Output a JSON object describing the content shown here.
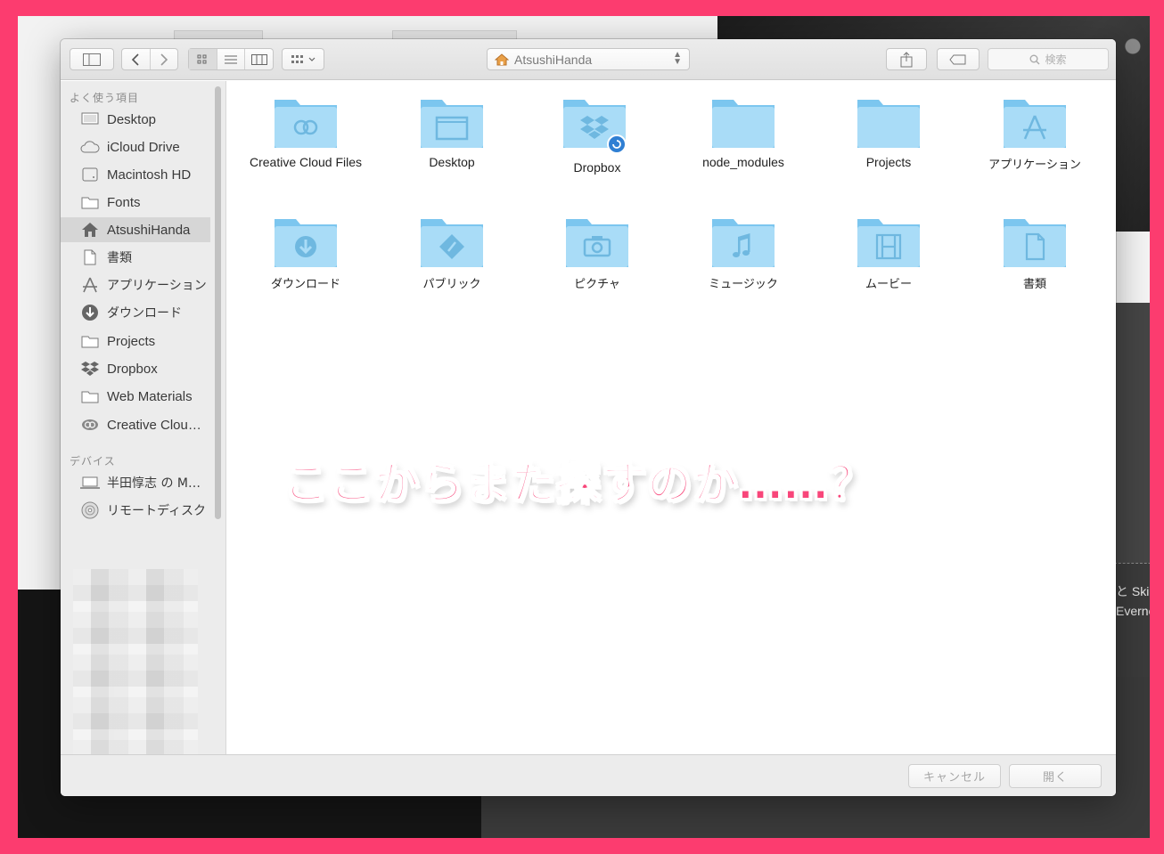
{
  "background": {
    "note_card_lines": [
      "と Ski",
      "Everno"
    ]
  },
  "toolbar": {
    "path_label": "AtsushiHanda",
    "search_placeholder": "検索",
    "icons": [
      "sidebar-toggle-icon",
      "back-icon",
      "forward-icon",
      "icon-view-icon",
      "list-view-icon",
      "column-view-icon",
      "group-arrange-icon",
      "share-icon",
      "tag-icon",
      "search-icon"
    ]
  },
  "sidebar": {
    "favorites_heading": "よく使う項目",
    "favorites": [
      {
        "label": "Desktop",
        "icon": "desktop-icon"
      },
      {
        "label": "iCloud Drive",
        "icon": "cloud-icon"
      },
      {
        "label": "Macintosh HD",
        "icon": "drive-icon"
      },
      {
        "label": "Fonts",
        "icon": "folder-icon"
      },
      {
        "label": "AtsushiHanda",
        "icon": "home-icon",
        "selected": true
      },
      {
        "label": "書類",
        "icon": "documents-icon"
      },
      {
        "label": "アプリケーション",
        "icon": "applications-icon"
      },
      {
        "label": "ダウンロード",
        "icon": "download-icon"
      },
      {
        "label": "Projects",
        "icon": "folder-icon"
      },
      {
        "label": "Dropbox",
        "icon": "dropbox-icon"
      },
      {
        "label": "Web Materials",
        "icon": "folder-icon"
      },
      {
        "label": "Creative Clou…",
        "icon": "creative-cloud-icon"
      }
    ],
    "devices_heading": "デバイス",
    "devices": [
      {
        "label": "半田惇志 の M…",
        "icon": "laptop-icon"
      },
      {
        "label": "リモートディスク",
        "icon": "disc-icon"
      }
    ]
  },
  "files": [
    {
      "label": "Creative Cloud Files",
      "glyph": "creative-cloud-icon"
    },
    {
      "label": "Desktop",
      "glyph": "window-icon"
    },
    {
      "label": "Dropbox",
      "glyph": "dropbox-icon"
    },
    {
      "label": "node_modules",
      "glyph": ""
    },
    {
      "label": "Projects",
      "glyph": ""
    },
    {
      "label": "アプリケーション",
      "glyph": "applications-icon"
    },
    {
      "label": "ダウンロード",
      "glyph": "download-icon"
    },
    {
      "label": "パブリック",
      "glyph": "public-icon"
    },
    {
      "label": "ピクチャ",
      "glyph": "camera-icon"
    },
    {
      "label": "ミュージック",
      "glyph": "music-icon"
    },
    {
      "label": "ムービー",
      "glyph": "film-icon"
    },
    {
      "label": "書類",
      "glyph": "document-icon"
    }
  ],
  "annotation": "ここからまた探すのか……？",
  "footer": {
    "cancel_label": "キャンセル",
    "open_label": "開く"
  },
  "colors": {
    "frame": "#fc3c6f",
    "annotation": "#f8467a",
    "folder_light": "#a9dcf7",
    "folder_dark": "#7cc6ef",
    "badge": "#2f7fd3"
  }
}
